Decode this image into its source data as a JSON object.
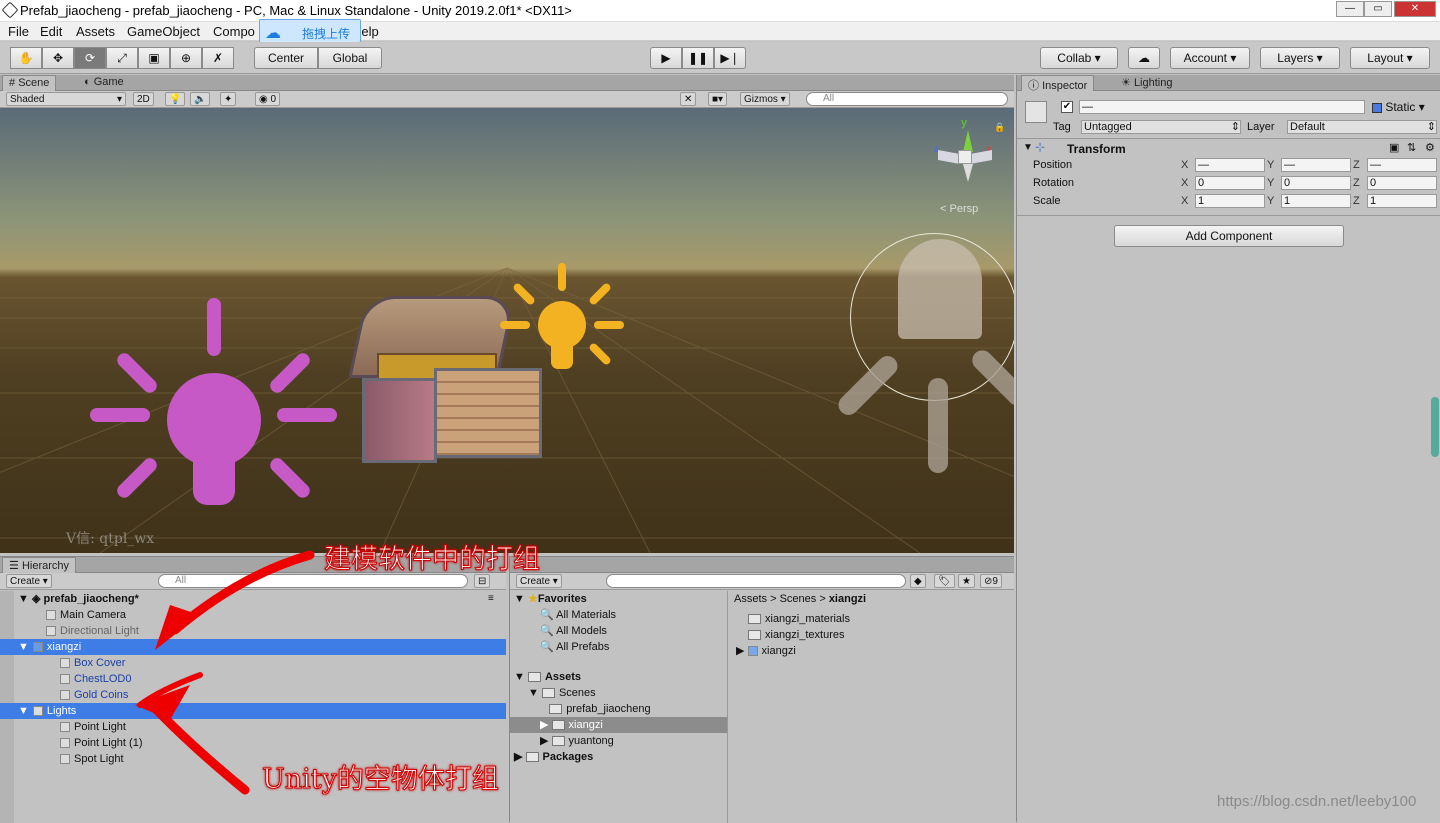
{
  "window": {
    "title": "Prefab_jiaocheng - prefab_jiaocheng - PC, Mac & Linux Standalone - Unity 2019.2.0f1* <DX11>"
  },
  "menu": [
    "File",
    "Edit",
    "Assets",
    "GameObject",
    "Compo",
    "Help"
  ],
  "upload_overlay": "拖拽上传",
  "toolbar": {
    "center": "Center",
    "global": "Global",
    "collab": "Collab",
    "account": "Account",
    "layers": "Layers",
    "layout": "Layout"
  },
  "scene": {
    "tab_scene": "Scene",
    "tab_game": "Game",
    "shading": "Shaded",
    "mode_2d": "2D",
    "hidden_count": "0",
    "gizmos": "Gizmos",
    "search_placeholder": "All",
    "persp": "Persp",
    "watermark": "V信: qtpl_wx",
    "axis_x": "x",
    "axis_y": "y",
    "axis_z": "z"
  },
  "inspector": {
    "tab_inspector": "Inspector",
    "tab_lighting": "Lighting",
    "name_value": "—",
    "static_label": "Static",
    "tag_label": "Tag",
    "tag_value": "Untagged",
    "layer_label": "Layer",
    "layer_value": "Default",
    "transform_title": "Transform",
    "rows": [
      {
        "label": "Position",
        "x": "—",
        "y": "—",
        "z": "—"
      },
      {
        "label": "Rotation",
        "x": "0",
        "y": "0",
        "z": "0"
      },
      {
        "label": "Scale",
        "x": "1",
        "y": "1",
        "z": "1"
      }
    ],
    "xyz": [
      "X",
      "Y",
      "Z"
    ],
    "add_component": "Add Component"
  },
  "hierarchy": {
    "tab": "Hierarchy",
    "create": "Create",
    "search_placeholder": "All",
    "scene_name": "prefab_jiaocheng*",
    "items": [
      "Main Camera",
      "Directional Light",
      "xiangzi",
      "Box Cover",
      "ChestLOD0",
      "Gold Coins",
      "Lights",
      "Point Light",
      "Point Light (1)",
      "Spot Light"
    ]
  },
  "project": {
    "create": "Create",
    "hidden_count": "9",
    "favorites": "Favorites",
    "fav_items": [
      "All Materials",
      "All Models",
      "All Prefabs"
    ],
    "assets": "Assets",
    "scenes": "Scenes",
    "scene_children": [
      "prefab_jiaocheng",
      "xiangzi",
      "yuantong"
    ],
    "packages": "Packages",
    "breadcrumb": [
      "Assets",
      "Scenes",
      "xiangzi"
    ],
    "folder_items": [
      "xiangzi_materials",
      "xiangzi_textures",
      "xiangzi"
    ]
  },
  "annotations": {
    "top": "建模软件中的打组",
    "bottom": "Unity的空物体打组"
  },
  "footer_watermark": "https://blog.csdn.net/leeby100"
}
